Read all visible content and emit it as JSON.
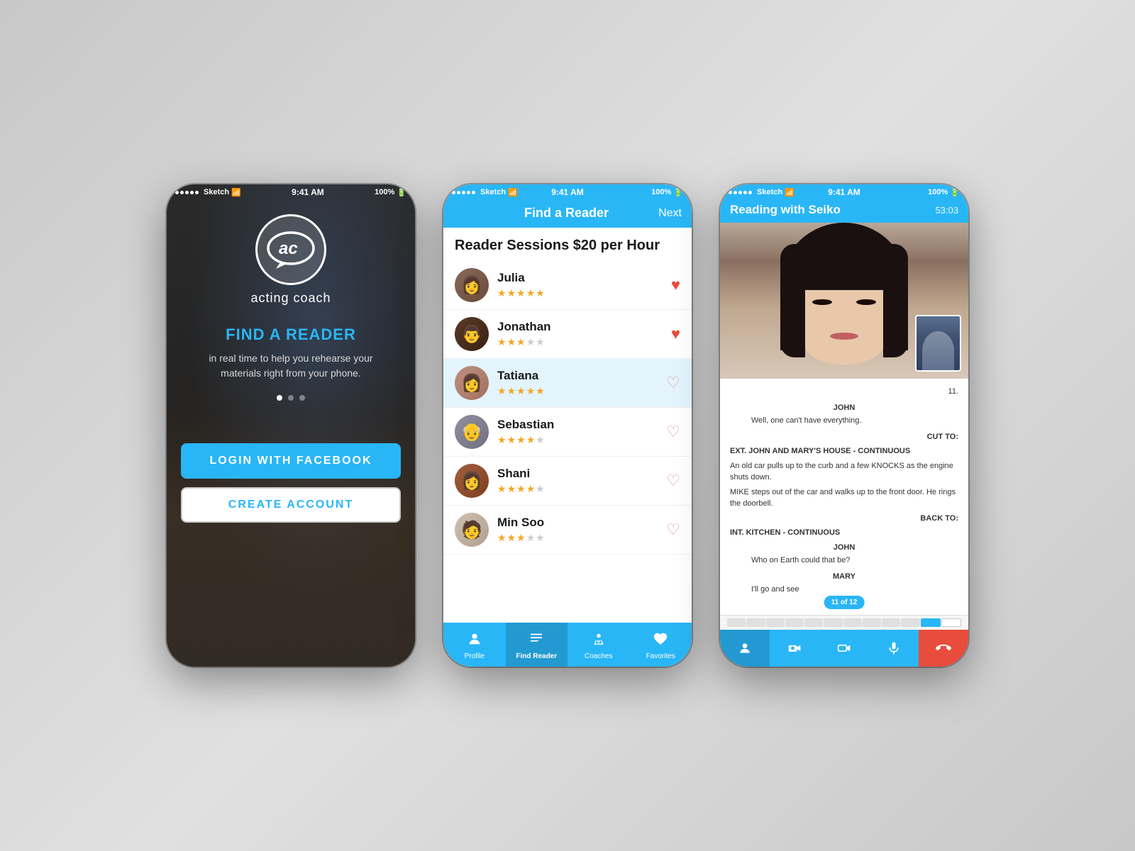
{
  "phone1": {
    "statusBar": {
      "carrier": "Sketch",
      "time": "9:41 AM",
      "battery": "100%"
    },
    "logo": "ac",
    "appName": "acting coach",
    "headline": "FIND A READER",
    "subtitle": "in real time to help you rehearse your\nmaterials right from your phone.",
    "dots": [
      "active",
      "inactive",
      "inactive"
    ],
    "btn_facebook": "LOGIN WITH FACEBOOK",
    "btn_create": "CREATE ACCOUNT"
  },
  "phone2": {
    "statusBar": {
      "carrier": "Sketch",
      "time": "9:41 AM",
      "battery": "100%"
    },
    "navTitle": "Find a Reader",
    "navAction": "Next",
    "sectionHeader": "Reader Sessions $20 per Hour",
    "readers": [
      {
        "name": "Julia",
        "stars": [
          1,
          1,
          1,
          1,
          0.5
        ],
        "liked": true,
        "selected": false
      },
      {
        "name": "Jonathan",
        "stars": [
          1,
          1,
          1,
          0,
          0
        ],
        "liked": true,
        "selected": false
      },
      {
        "name": "Tatiana",
        "stars": [
          1,
          1,
          1,
          1,
          0.5
        ],
        "liked": false,
        "selected": true
      },
      {
        "name": "Sebastian",
        "stars": [
          1,
          1,
          1,
          0.5,
          0
        ],
        "liked": false,
        "selected": false
      },
      {
        "name": "Shani",
        "stars": [
          1,
          1,
          1,
          0.5,
          0
        ],
        "liked": false,
        "selected": false
      },
      {
        "name": "Min Soo",
        "stars": [
          1,
          1,
          1,
          0,
          0
        ],
        "liked": false,
        "selected": false
      }
    ],
    "tabs": [
      {
        "icon": "👤",
        "label": "Profile",
        "active": false
      },
      {
        "icon": "📋",
        "label": "Find Reader",
        "active": true
      },
      {
        "icon": "🎭",
        "label": "Coaches",
        "active": false
      },
      {
        "icon": "♡",
        "label": "Favorites",
        "active": false
      }
    ]
  },
  "phone3": {
    "statusBar": {
      "carrier": "Sketch",
      "time": "9:41 AM",
      "battery": "100%"
    },
    "navTitle": "Reading with Seiko",
    "navSubtitle": "53:03",
    "pageNum": "11.",
    "script": [
      {
        "type": "character",
        "text": "JOHN"
      },
      {
        "type": "dialogue",
        "text": "Well, one can't have everything."
      },
      {
        "type": "transition",
        "text": "CUT TO:"
      },
      {
        "type": "heading",
        "text": "EXT. JOHN AND MARY'S HOUSE - CONTINUOUS"
      },
      {
        "type": "action",
        "text": "An old car pulls up to the curb and a few KNOCKS as the engine shuts down."
      },
      {
        "type": "action",
        "text": "MIKE steps out of the car and walks up to the front door. He rings the doorbell."
      },
      {
        "type": "transition",
        "text": "BACK TO:"
      },
      {
        "type": "heading",
        "text": "INT. KITCHEN - CONTINUOUS"
      },
      {
        "type": "character",
        "text": "JOHN"
      },
      {
        "type": "dialogue",
        "text": "Who on Earth could that be?"
      },
      {
        "type": "character",
        "text": "MARY"
      },
      {
        "type": "dialogue",
        "text": "I'll go and see"
      }
    ],
    "pageIndicator": "11 of 12",
    "progressPercent": 91,
    "actionBtns": [
      "👤",
      "📷",
      "🎥",
      "🎤",
      "📞"
    ]
  }
}
